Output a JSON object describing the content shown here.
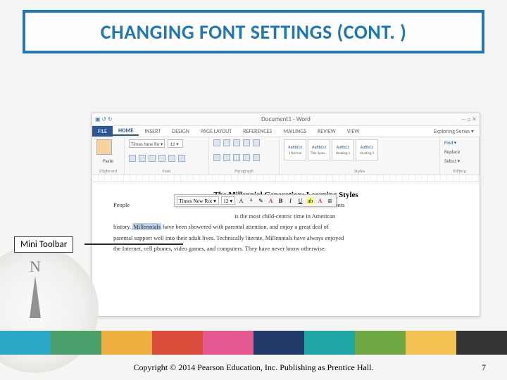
{
  "slide": {
    "title": "CHANGING FONT SETTINGS (CONT. )"
  },
  "word": {
    "window_title": "Document1 - Word",
    "account_label": "Exploring Series ▾",
    "tabs": {
      "file": "FILE",
      "home": "HOME",
      "insert": "INSERT",
      "design": "DESIGN",
      "page_layout": "PAGE LAYOUT",
      "references": "REFERENCES",
      "mailings": "MAILINGS",
      "review": "REVIEW",
      "view": "VIEW"
    },
    "ribbon": {
      "clipboard_label": "Clipboard",
      "paste_label": "Paste",
      "font_label": "Font",
      "font_name": "Times New Ro ▾",
      "font_size": "12 ▾",
      "paragraph_label": "Paragraph",
      "styles_label": "Styles",
      "editing_label": "Editing",
      "find_label": "Find ▾",
      "replace_label": "Replace",
      "select_label": "Select ▾",
      "styles": [
        {
          "sample": "AaBbCcI",
          "name": "1 Normal"
        },
        {
          "sample": "AaBbCcI",
          "name": "Title Spaci..."
        },
        {
          "sample": "AaBbCc",
          "name": "Heading 1"
        },
        {
          "sample": "AaBbCc",
          "name": "Heading 2"
        }
      ]
    },
    "mini_toolbar": {
      "font_name": "Times New Rot ▾",
      "font_size": "12 ▾",
      "grow": "A",
      "shrink": "A",
      "format_painter": "✎",
      "bold": "B",
      "italic": "I",
      "underline": "U",
      "highlight": "ab",
      "color_a": "A",
      "bullets": "≣",
      "styles": "A"
    },
    "document": {
      "heading": "The Millennial Generation: Learning Styles",
      "line1_pre": "People",
      "line1_post": "wn as the Millennial Generation. Members",
      "line2_post": "is the most child-centric time in American",
      "line3_pre": "history. ",
      "highlighted": "Millennials",
      "line3_post": " have been showered with parental attention, and enjoy a great deal of",
      "line4": "parental support well into their adult lives. Technically literate, Millennials have always enjoyed",
      "line5": "the Internet, cell phones, video games, and computers. They have never know otherwise."
    }
  },
  "callout": {
    "label": "Mini Toolbar"
  },
  "footer": {
    "copyright": "Copyright © 2014 Pearson Education, Inc. Publishing as Prentice Hall.",
    "page": "7"
  }
}
